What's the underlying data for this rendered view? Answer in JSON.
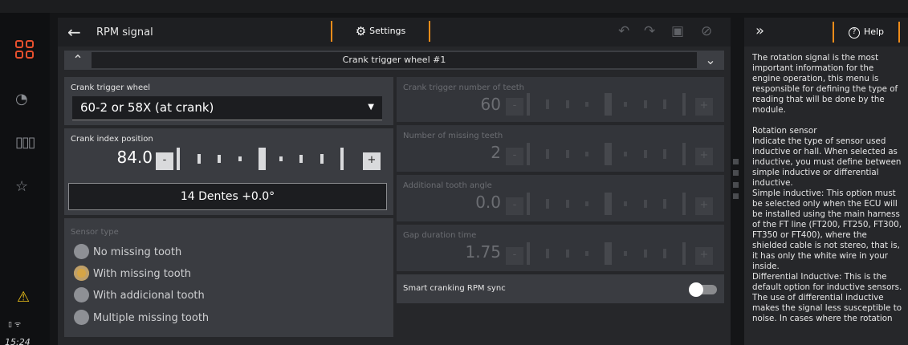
{
  "status": {
    "time": "15:24",
    "icons": "▯ ᯤ"
  },
  "header": {
    "title": "RPM signal",
    "settings_tab": "Settings",
    "back_icon": "arrow-left-icon"
  },
  "section": {
    "name": "Crank trigger wheel #1"
  },
  "crank_wheel": {
    "label": "Crank trigger wheel",
    "value": "60-2 or 58X (at crank)"
  },
  "crank_index": {
    "label": "Crank index position",
    "value": "84.0",
    "readout": "14 Dentes +0.0°"
  },
  "sensor_type": {
    "label": "Sensor type",
    "options": [
      "No missing tooth",
      "With missing tooth",
      "With addicional tooth",
      "Multiple missing tooth"
    ],
    "selected": "With missing tooth"
  },
  "teeth": {
    "label": "Crank trigger number of teeth",
    "value": "60"
  },
  "missing": {
    "label": "Number of missing teeth",
    "value": "2"
  },
  "add_angle": {
    "label": "Additional tooth angle",
    "value": "0.0"
  },
  "gap": {
    "label": "Gap duration time",
    "value": "1.75"
  },
  "smart": {
    "label": "Smart cranking RPM sync",
    "enabled": false
  },
  "stepper": {
    "minus": "-",
    "plus": "+"
  },
  "help": {
    "tab": "Help",
    "text": "The rotation signal is the most important information for the engine operation, this menu is responsible for defining the type of reading that will be done by the module.\n\nRotation sensor\nIndicate the type of sensor used inductive or hall. When selected as inductive, you must define between simple inductive or differential inductive.\nSimple inductive: This option must be selected only when the ECU will be installed using the main harness of the FT line (FT200, FT250, FT300, FT350 or FT400), where the shielded cable is not stereo, that is, it has only the white wire in your inside.\nDifferential Inductive: This is the default option for inductive sensors. The use of differential inductive makes the signal less susceptible to noise. In cases where the rotation"
  },
  "colors": {
    "accent": "#f08c1a",
    "apps_icon": "#e8502e",
    "warning": "#f0c419",
    "radio_selected": "#d6a545"
  }
}
